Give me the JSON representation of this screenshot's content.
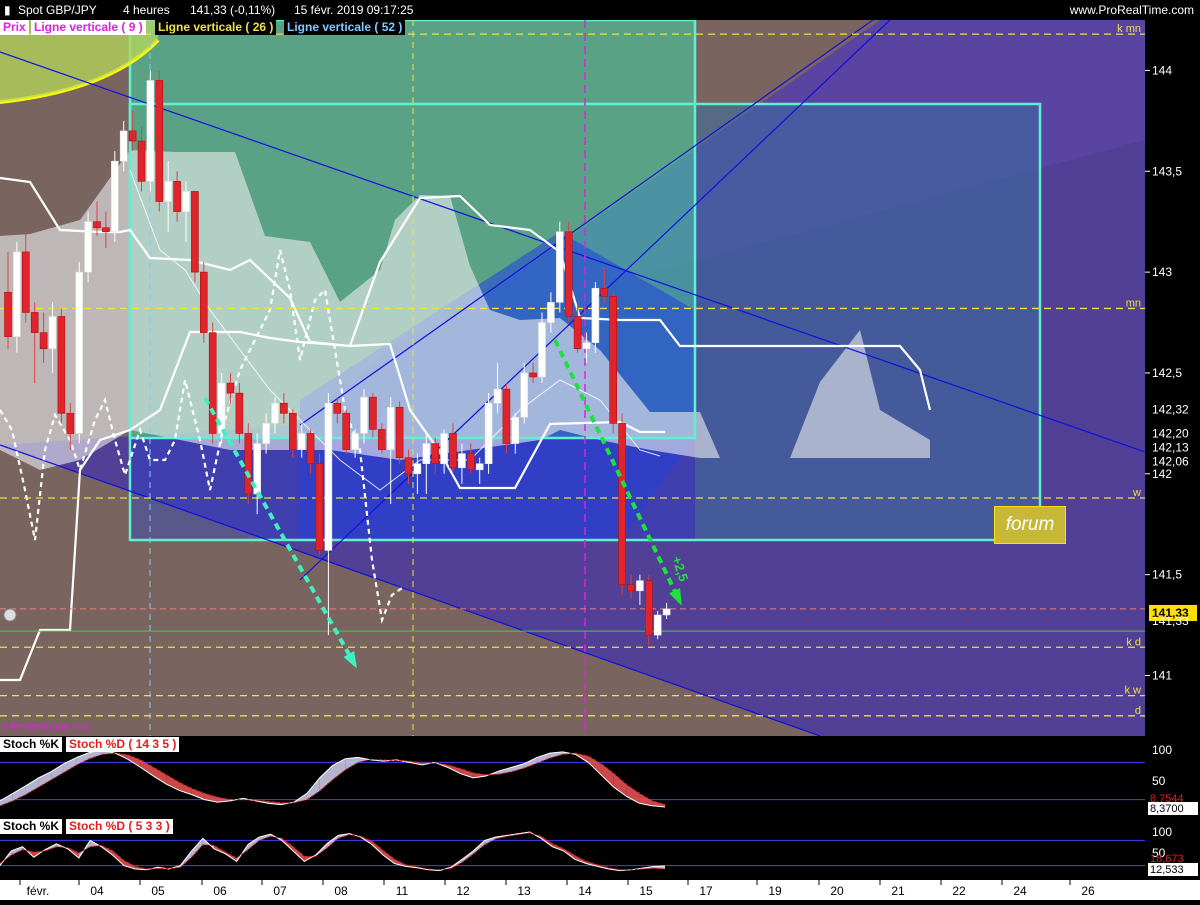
{
  "header": {
    "symbol": "Spot GBP/JPY",
    "timeframe": "4 heures",
    "last": "141,33 (-0,11%)",
    "datetime": "15 févr. 2019 09:17:25",
    "site": "www.ProRealTime.com"
  },
  "legend": {
    "prix": "Prix",
    "v9": "Ligne verticale ( 9 )",
    "v26": "Ligne verticale ( 26 )",
    "v52": "Ligne verticale ( 52 )"
  },
  "watermark": "© ProRealTime.com",
  "forum_label": "forum",
  "annotation_arrow": "+2,5",
  "colors": {
    "bg_brown": "#7a645f",
    "box_green": "#3fd6a6",
    "box_blue": "#2040e0",
    "channel_line": "#1010e0",
    "cloud": "#e8eaee",
    "candle_up": "#ffffff",
    "candle_down": "#e0242c",
    "level_yellow": "#f0e040",
    "rect_border": "#60f0d0",
    "arrow_green": "#20e040",
    "arrow_cyan": "#40f0c0"
  },
  "chart_data": [
    {
      "type": "candlestick",
      "title": "",
      "y_axis": {
        "ylim": [
          140.7,
          144.25
        ],
        "ticks": [
          "144",
          "143,5",
          "143",
          "142,5",
          "142",
          "141,5",
          "141"
        ],
        "tick_values": [
          144,
          143.5,
          143,
          142.5,
          142,
          141.5,
          141
        ]
      },
      "x_axis": {
        "labels": [
          "févr.",
          "04",
          "05",
          "06",
          "07",
          "08",
          "11",
          "12",
          "13",
          "14",
          "15",
          "17",
          "19",
          "20",
          "21",
          "22",
          "24",
          "26"
        ]
      },
      "price_labels": [
        {
          "text": "142,32",
          "value": 142.32
        },
        {
          "text": "142,20",
          "value": 142.2
        },
        {
          "text": "142,13",
          "value": 142.13
        },
        {
          "text": "142,06",
          "value": 142.06
        },
        {
          "text": "141,33",
          "value": 141.31,
          "highlight": true
        },
        {
          "text": "141,33",
          "value": 141.27
        }
      ],
      "levels": [
        {
          "label": "k mn",
          "value": 144.18
        },
        {
          "label": "mn",
          "value": 142.82
        },
        {
          "label": "w",
          "value": 141.88
        },
        {
          "label": "k d",
          "value": 141.14
        },
        {
          "label": "k w",
          "value": 140.9
        },
        {
          "label": "d",
          "value": 140.8
        }
      ],
      "candles": [
        [
          142.9,
          143.1,
          142.62,
          142.68
        ],
        [
          142.68,
          143.15,
          142.6,
          143.1
        ],
        [
          143.1,
          143.2,
          142.75,
          142.8
        ],
        [
          142.8,
          142.85,
          142.45,
          142.7
        ],
        [
          142.7,
          142.8,
          142.55,
          142.62
        ],
        [
          142.62,
          142.85,
          142.5,
          142.78
        ],
        [
          142.78,
          142.82,
          142.25,
          142.3
        ],
        [
          142.3,
          142.35,
          142.12,
          142.2
        ],
        [
          142.2,
          143.05,
          142.15,
          143.0
        ],
        [
          143.0,
          143.3,
          142.95,
          143.25
        ],
        [
          143.25,
          143.35,
          143.18,
          143.22
        ],
        [
          143.22,
          143.3,
          143.12,
          143.2
        ],
        [
          143.2,
          143.6,
          143.15,
          143.55
        ],
        [
          143.55,
          143.75,
          143.5,
          143.7
        ],
        [
          143.7,
          143.8,
          143.6,
          143.65
        ],
        [
          143.65,
          143.72,
          143.4,
          143.45
        ],
        [
          143.45,
          144.0,
          143.4,
          143.95
        ],
        [
          143.95,
          144.0,
          143.3,
          143.35
        ],
        [
          143.35,
          143.55,
          143.2,
          143.45
        ],
        [
          143.45,
          143.5,
          143.25,
          143.3
        ],
        [
          143.3,
          143.45,
          143.15,
          143.4
        ],
        [
          143.4,
          143.4,
          142.95,
          143.0
        ],
        [
          143.0,
          143.05,
          142.65,
          142.7
        ],
        [
          142.7,
          142.75,
          142.15,
          142.2
        ],
        [
          142.2,
          142.5,
          142.15,
          142.45
        ],
        [
          142.45,
          142.5,
          142.35,
          142.4
        ],
        [
          142.4,
          142.45,
          142.15,
          142.2
        ],
        [
          142.2,
          142.25,
          141.85,
          141.9
        ],
        [
          141.9,
          142.2,
          141.8,
          142.15
        ],
        [
          142.15,
          142.3,
          142.1,
          142.25
        ],
        [
          142.25,
          142.38,
          142.2,
          142.35
        ],
        [
          142.35,
          142.4,
          142.25,
          142.3
        ],
        [
          142.3,
          142.32,
          142.08,
          142.12
        ],
        [
          142.12,
          142.25,
          142.08,
          142.2
        ],
        [
          142.2,
          142.22,
          142.0,
          142.05
        ],
        [
          142.05,
          142.1,
          141.6,
          141.62
        ],
        [
          141.62,
          142.4,
          141.2,
          142.35
        ],
        [
          142.35,
          142.38,
          142.25,
          142.3
        ],
        [
          142.3,
          142.32,
          142.1,
          142.12
        ],
        [
          142.12,
          142.22,
          142.08,
          142.2
        ],
        [
          142.2,
          142.42,
          142.15,
          142.38
        ],
        [
          142.38,
          142.4,
          142.18,
          142.22
        ],
        [
          142.22,
          142.25,
          142.1,
          142.12
        ],
        [
          142.12,
          142.38,
          141.85,
          142.33
        ],
        [
          142.33,
          142.36,
          142.05,
          142.08
        ],
        [
          142.08,
          142.12,
          141.95,
          142.0
        ],
        [
          142.0,
          142.1,
          141.9,
          142.05
        ],
        [
          142.05,
          142.2,
          141.9,
          142.15
        ],
        [
          142.15,
          142.18,
          142.0,
          142.05
        ],
        [
          142.05,
          142.22,
          142.0,
          142.2
        ],
        [
          142.2,
          142.25,
          142.0,
          142.03
        ],
        [
          142.03,
          142.15,
          141.95,
          142.1
        ],
        [
          142.1,
          142.15,
          142.0,
          142.02
        ],
        [
          142.02,
          142.08,
          141.95,
          142.05
        ],
        [
          142.05,
          142.4,
          142.0,
          142.35
        ],
        [
          142.35,
          142.55,
          142.3,
          142.42
        ],
        [
          142.42,
          142.45,
          142.1,
          142.15
        ],
        [
          142.15,
          142.3,
          142.1,
          142.28
        ],
        [
          142.28,
          142.55,
          142.25,
          142.5
        ],
        [
          142.5,
          142.55,
          142.45,
          142.48
        ],
        [
          142.48,
          142.8,
          142.45,
          142.75
        ],
        [
          142.75,
          142.9,
          142.7,
          142.85
        ],
        [
          142.85,
          143.25,
          142.8,
          143.2
        ],
        [
          143.2,
          143.25,
          142.75,
          142.78
        ],
        [
          142.78,
          142.85,
          142.6,
          142.62
        ],
        [
          142.62,
          142.7,
          142.55,
          142.65
        ],
        [
          142.65,
          142.95,
          142.6,
          142.92
        ],
        [
          142.92,
          143.02,
          142.85,
          142.88
        ],
        [
          142.88,
          142.9,
          142.2,
          142.25
        ],
        [
          142.25,
          142.3,
          141.4,
          141.45
        ],
        [
          141.45,
          141.5,
          141.38,
          141.42
        ],
        [
          141.42,
          141.5,
          141.35,
          141.47
        ],
        [
          141.47,
          141.5,
          141.15,
          141.2
        ],
        [
          141.2,
          141.32,
          141.18,
          141.3
        ],
        [
          141.3,
          141.36,
          141.28,
          141.33
        ]
      ]
    },
    {
      "type": "line",
      "title": "",
      "series": [
        {
          "name": "Stoch %K",
          "values": [
            18,
            30,
            42,
            55,
            65,
            78,
            88,
            96,
            100,
            95,
            85,
            72,
            58,
            45,
            35,
            28,
            20,
            16,
            18,
            22,
            18,
            14,
            12,
            16,
            30,
            55,
            75,
            86,
            88,
            84,
            82,
            84,
            80,
            76,
            80,
            72,
            62,
            55,
            58,
            66,
            72,
            78,
            88,
            95,
            97,
            93,
            80,
            60,
            40,
            25,
            14,
            10,
            8
          ]
        },
        {
          "name": "Stoch %D ( 14 3 5 )",
          "values": [
            10,
            18,
            28,
            40,
            52,
            64,
            76,
            86,
            93,
            95,
            92,
            84,
            72,
            60,
            48,
            38,
            30,
            24,
            20,
            20,
            19,
            17,
            15,
            15,
            20,
            34,
            52,
            68,
            80,
            85,
            84,
            83,
            82,
            79,
            79,
            76,
            70,
            63,
            60,
            61,
            65,
            71,
            79,
            87,
            93,
            95,
            90,
            78,
            62,
            44,
            30,
            18,
            12
          ]
        }
      ],
      "ylim": [
        0,
        100
      ],
      "ticks": [
        "100",
        "50"
      ],
      "last_values": [
        "8,7544",
        "8,3700"
      ]
    },
    {
      "type": "line",
      "title": "",
      "series": [
        {
          "name": "Stoch %K",
          "values": [
            20,
            55,
            65,
            40,
            58,
            72,
            60,
            38,
            80,
            65,
            45,
            20,
            12,
            10,
            16,
            12,
            20,
            55,
            85,
            60,
            48,
            30,
            70,
            88,
            95,
            80,
            55,
            30,
            45,
            72,
            92,
            96,
            88,
            70,
            45,
            25,
            18,
            15,
            10,
            8,
            16,
            35,
            55,
            80,
            88,
            92,
            96,
            100,
            85,
            65,
            55,
            35,
            25,
            18,
            12,
            8,
            10,
            14,
            18,
            19
          ]
        },
        {
          "name": "Stoch %D ( 5 3 3 )",
          "values": [
            25,
            45,
            58,
            52,
            55,
            65,
            63,
            50,
            65,
            68,
            55,
            32,
            18,
            12,
            13,
            13,
            16,
            40,
            70,
            68,
            52,
            38,
            58,
            80,
            90,
            85,
            65,
            42,
            42,
            62,
            85,
            94,
            90,
            78,
            56,
            35,
            22,
            17,
            12,
            10,
            13,
            28,
            48,
            70,
            84,
            90,
            94,
            98,
            90,
            72,
            60,
            44,
            30,
            22,
            15,
            10,
            10,
            12,
            14,
            12
          ]
        }
      ],
      "ylim": [
        0,
        100
      ],
      "ticks": [
        "100",
        "50"
      ],
      "last_values": [
        "18,673",
        "12,533"
      ]
    }
  ]
}
